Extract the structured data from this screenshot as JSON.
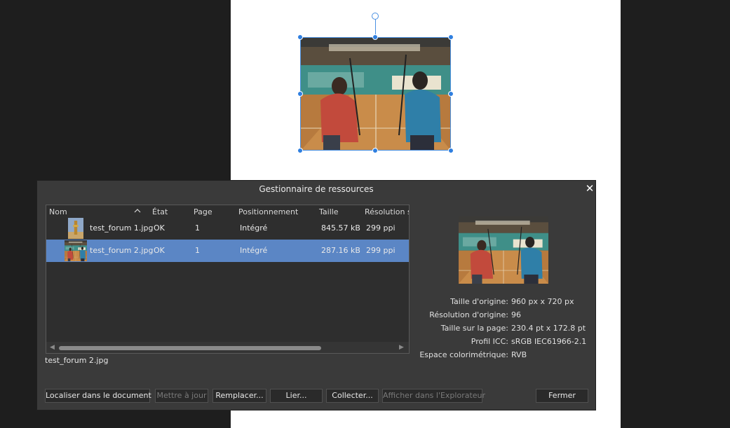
{
  "dialog": {
    "title": "Gestionnaire de ressources",
    "columns": [
      "Nom",
      "État",
      "Page",
      "Positionnement",
      "Taille",
      "Résolution su"
    ],
    "rows": [
      {
        "name": "test_forum 1.jpg",
        "state": "OK",
        "page": "1",
        "placement": "Intégré",
        "size": "845.57 kB",
        "resolution": "299 ppi",
        "selected": false
      },
      {
        "name": "test_forum 2.jpg",
        "state": "OK",
        "page": "1",
        "placement": "Intégré",
        "size": "287.16 kB",
        "resolution": "299 ppi",
        "selected": true
      }
    ],
    "selected_file": "test_forum 2.jpg",
    "info": [
      {
        "label": "Taille d'origine:",
        "value": "960 px x 720 px"
      },
      {
        "label": "Résolution d'origine:",
        "value": "96"
      },
      {
        "label": "Taille sur la page:",
        "value": "230.4 pt x 172.8 pt"
      },
      {
        "label": "Profil ICC:",
        "value": "sRGB IEC61966-2.1"
      },
      {
        "label": "Espace colorimétrique:",
        "value": "RVB"
      }
    ],
    "buttons": [
      {
        "label": "Localiser dans le document",
        "enabled": true
      },
      {
        "label": "Mettre à jour",
        "enabled": false
      },
      {
        "label": "Remplacer...",
        "enabled": true
      },
      {
        "label": "Lier...",
        "enabled": true
      },
      {
        "label": "Collecter...",
        "enabled": true
      },
      {
        "label": "Afficher dans l'Explorateur",
        "enabled": false
      },
      {
        "label": "Fermer",
        "enabled": true
      }
    ]
  },
  "colors": {
    "selection_blue": "#4a90e2",
    "row_selected": "#5b86c5",
    "dialog_bg": "#3a3a3a"
  },
  "icons": [
    "close-icon",
    "sort-up-icon",
    "scroll-left-icon",
    "scroll-right-icon",
    "rotation-handle-icon"
  ]
}
